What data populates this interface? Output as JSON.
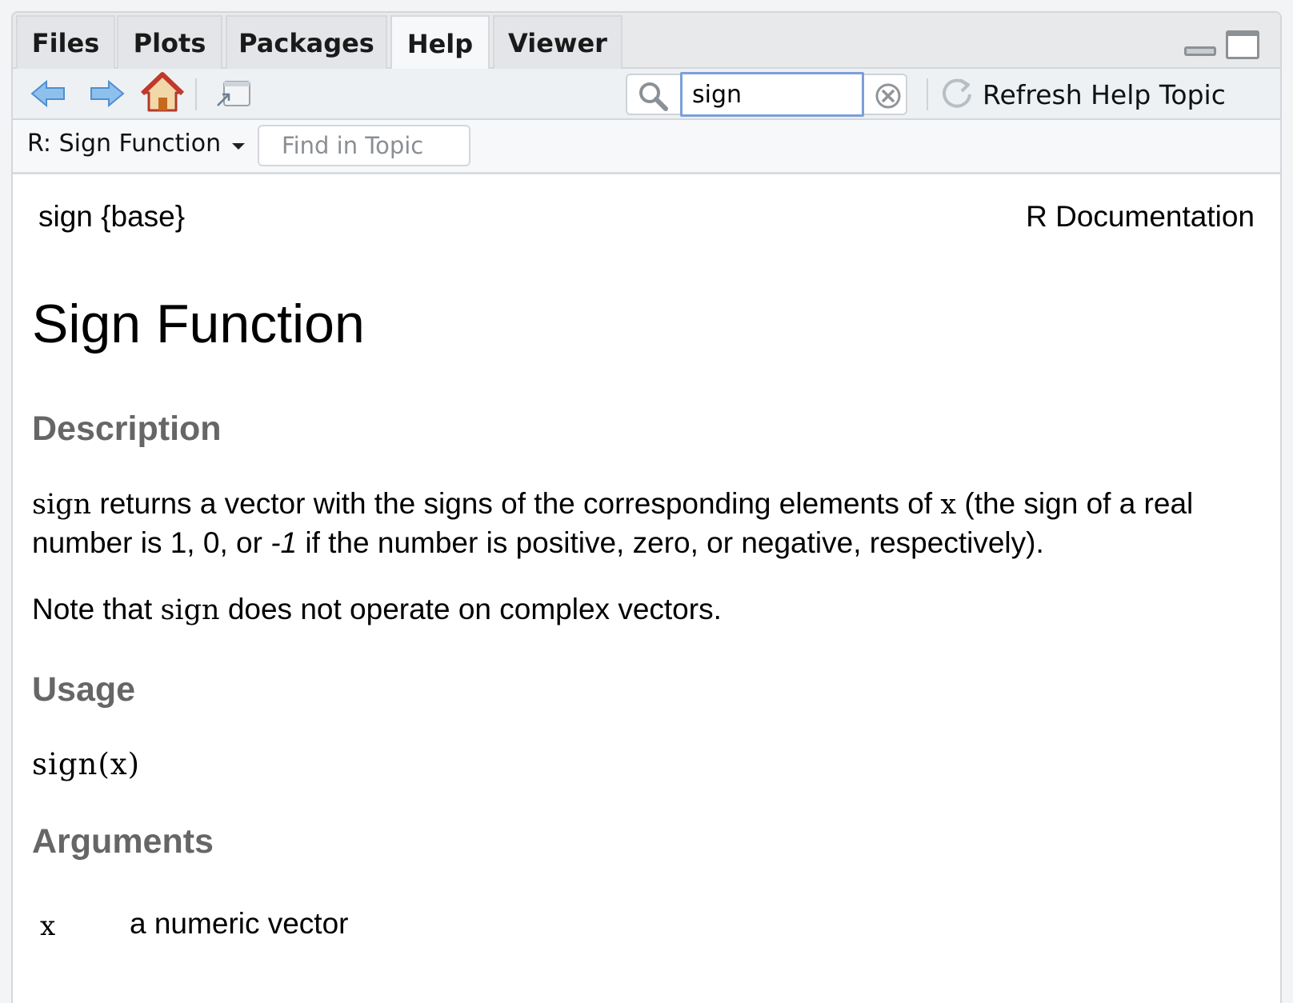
{
  "tabs": [
    "Files",
    "Plots",
    "Packages",
    "Help",
    "Viewer"
  ],
  "active_tab": "Help",
  "toolbar": {
    "search_value": "sign",
    "refresh_label": "Refresh Help Topic"
  },
  "subtoolbar": {
    "topic": "R: Sign Function",
    "find_placeholder": "Find in Topic"
  },
  "doc": {
    "header_left": "sign {base}",
    "header_right": "R Documentation",
    "title": "Sign Function",
    "description_heading": "Description",
    "desc_code1": "sign",
    "desc_text1": " returns a vector with the signs of the corresponding elements of ",
    "desc_code2": "x",
    "desc_text2": " (the sign of a real number is 1, 0, or ",
    "desc_em": "-1",
    "desc_text3": " if the number is positive, zero, or negative, respectively).",
    "note_text1": "Note that ",
    "note_code": "sign",
    "note_text2": " does not operate on complex vectors.",
    "usage_heading": "Usage",
    "usage_code": "sign(x)",
    "arguments_heading": "Arguments",
    "arg_name": "x",
    "arg_desc": "a numeric vector"
  },
  "colors": {
    "accent_focus": "#7b9fdb",
    "heading_gray": "#666666",
    "nav_arrow": "#6fa8dc",
    "home_red": "#c0392b"
  }
}
